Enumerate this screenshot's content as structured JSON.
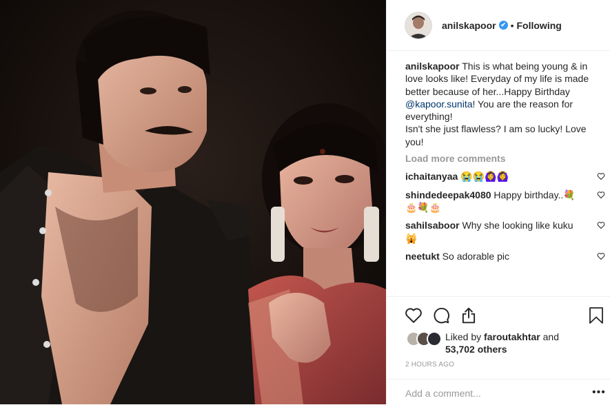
{
  "post": {
    "username": "anilskapoor",
    "verified_mark": "✔",
    "dot": "•",
    "follow_state": "Following",
    "caption": {
      "username": "anilskapoor",
      "text_part1": " This is what being young & in love looks like! Everyday of my life is made better because of her...Happy Birthday ",
      "mention": "@kapoor.sunita",
      "text_part2": "! You are the reason for everything!",
      "text_part3": "Isn't she just flawless? I am so lucky! Love you!"
    },
    "load_more_label": "Load more comments",
    "comments": [
      {
        "username": "ichaitanyaa",
        "text": " 😭😭🙆‍♀️🙆‍♀️"
      },
      {
        "username": "shindedeepak4080",
        "text": " Happy birthday..💐🎂💐🎂"
      },
      {
        "username": "sahilsaboor",
        "text": " Why she looking like kuku 🙀"
      },
      {
        "username": "neetukt",
        "text": " So adorable pic"
      }
    ],
    "likes": {
      "prefix": "Liked by ",
      "user": "faroutakhtar",
      "middle": " and ",
      "count": "53,702 others"
    },
    "timestamp": "2 HOURS AGO",
    "add_comment_placeholder": "Add a comment...",
    "more_label": "•••"
  },
  "icons": [
    "heart-icon",
    "comment-icon",
    "share-icon",
    "bookmark-icon",
    "more-icon"
  ],
  "colors": {
    "link": "#003569",
    "muted": "#999999",
    "verified": "#3897f0",
    "border": "#efefef"
  }
}
